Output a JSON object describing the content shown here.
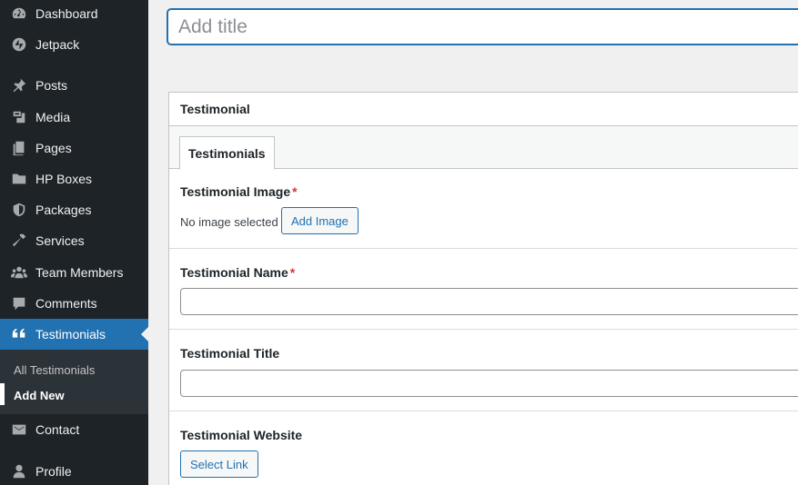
{
  "sidebar": {
    "items": [
      {
        "label": "Dashboard",
        "icon": "dashboard-icon"
      },
      {
        "label": "Jetpack",
        "icon": "jetpack-icon"
      },
      {
        "label": "Posts",
        "icon": "pin-icon"
      },
      {
        "label": "Media",
        "icon": "media-icon"
      },
      {
        "label": "Pages",
        "icon": "pages-icon"
      },
      {
        "label": "HP Boxes",
        "icon": "folder-icon"
      },
      {
        "label": "Packages",
        "icon": "shield-icon"
      },
      {
        "label": "Services",
        "icon": "hammer-icon"
      },
      {
        "label": "Team Members",
        "icon": "groups-icon"
      },
      {
        "label": "Comments",
        "icon": "comment-icon"
      },
      {
        "label": "Testimonials",
        "icon": "quote-icon",
        "active": true
      },
      {
        "label": "Contact",
        "icon": "email-icon"
      },
      {
        "label": "Profile",
        "icon": "user-icon"
      }
    ],
    "submenu": {
      "items": [
        {
          "label": "All Testimonials"
        },
        {
          "label": "Add New",
          "current": true
        }
      ]
    }
  },
  "editor": {
    "title_placeholder": "Add title"
  },
  "metabox": {
    "title": "Testimonial",
    "tabs": [
      {
        "label": "Testimonials"
      }
    ],
    "fields": {
      "image": {
        "label": "Testimonial Image",
        "required_mark": "*",
        "status": "No image selected",
        "button": "Add Image"
      },
      "name": {
        "label": "Testimonial Name",
        "required_mark": "*",
        "value": ""
      },
      "title": {
        "label": "Testimonial Title",
        "value": ""
      },
      "website": {
        "label": "Testimonial Website",
        "button": "Select Link"
      }
    }
  },
  "colors": {
    "sidebar_bg": "#1d2327",
    "accent": "#2271b1",
    "required": "#d63638"
  }
}
